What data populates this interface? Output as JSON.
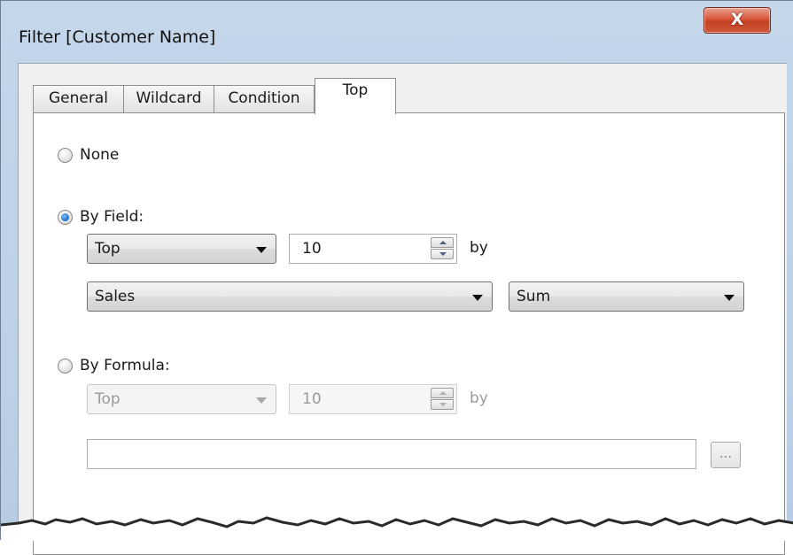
{
  "window": {
    "title": "Filter [Customer Name]",
    "close_glyph": "X"
  },
  "tabs": [
    {
      "label": "General",
      "active": false
    },
    {
      "label": "Wildcard",
      "active": false
    },
    {
      "label": "Condition",
      "active": false
    },
    {
      "label": "Top",
      "active": true
    }
  ],
  "top_panel": {
    "none": {
      "label": "None",
      "checked": false
    },
    "by_field": {
      "label": "By Field:",
      "checked": true,
      "direction": "Top",
      "count": "10",
      "by_label": "by",
      "field": "Sales",
      "aggregation": "Sum"
    },
    "by_formula": {
      "label": "By Formula:",
      "checked": false,
      "direction": "Top",
      "count": "10",
      "by_label": "by",
      "formula": "",
      "ellipsis_label": "..."
    }
  },
  "icons": {
    "close": "close-icon",
    "dropdown": "chevron-down-icon",
    "spin_up": "spin-up-icon",
    "spin_down": "spin-down-icon"
  },
  "colors": {
    "window_frame": "#c4d6ea",
    "close_button": "#c94a2b",
    "radio_selected": "#2a7fd4"
  }
}
